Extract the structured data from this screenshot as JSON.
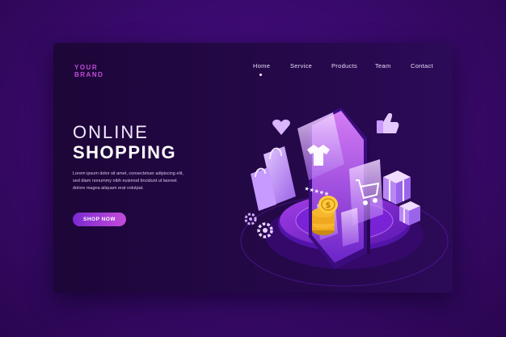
{
  "brand": {
    "line1": "YOUR",
    "line2": "BRAND"
  },
  "nav": {
    "items": [
      {
        "label": "Home"
      },
      {
        "label": "Service"
      },
      {
        "label": "Products"
      },
      {
        "label": "Team"
      },
      {
        "label": "Contact"
      }
    ],
    "active_index": 0
  },
  "hero": {
    "title_line1": "ONLINE",
    "title_line2": "SHOPPING",
    "body_lines": [
      "Lorem ipsum dolor sit amet, consectetuer adipiscing elit,",
      "sed diam nonummy nibh euismod tincidunt ut laoreet",
      "dolore magna aliquam erat volutpat."
    ],
    "cta_label": "SHOP NOW"
  },
  "illustration": {
    "coin_symbol": "$",
    "rating_stars": "★★★★★"
  },
  "colors": {
    "background": "#3a0a6e",
    "panel": "#240848",
    "accent": "#c24bd8",
    "button_start": "#7a2bd0",
    "button_end": "#c44bd8",
    "coin": "#f5b82e"
  },
  "icons": [
    "heart-icon",
    "thumbs-up-icon",
    "shopping-bag-icon",
    "gift-box-icon",
    "gear-icon",
    "shopping-cart-icon",
    "t-shirt-icon",
    "coin-icon"
  ]
}
